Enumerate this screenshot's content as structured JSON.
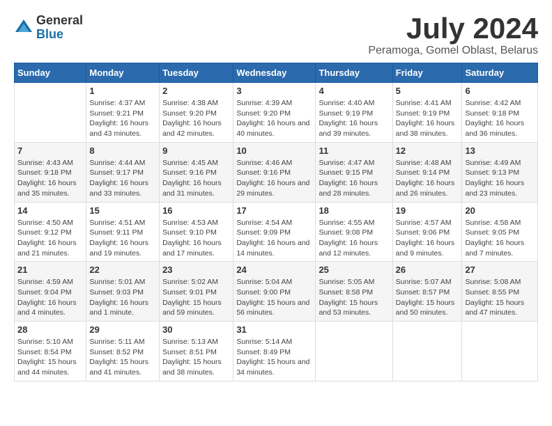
{
  "logo": {
    "general": "General",
    "blue": "Blue"
  },
  "title": {
    "month_year": "July 2024",
    "location": "Peramoga, Gomel Oblast, Belarus"
  },
  "headers": [
    "Sunday",
    "Monday",
    "Tuesday",
    "Wednesday",
    "Thursday",
    "Friday",
    "Saturday"
  ],
  "weeks": [
    [
      {
        "day": "",
        "info": ""
      },
      {
        "day": "1",
        "info": "Sunrise: 4:37 AM\nSunset: 9:21 PM\nDaylight: 16 hours and 43 minutes."
      },
      {
        "day": "2",
        "info": "Sunrise: 4:38 AM\nSunset: 9:20 PM\nDaylight: 16 hours and 42 minutes."
      },
      {
        "day": "3",
        "info": "Sunrise: 4:39 AM\nSunset: 9:20 PM\nDaylight: 16 hours and 40 minutes."
      },
      {
        "day": "4",
        "info": "Sunrise: 4:40 AM\nSunset: 9:19 PM\nDaylight: 16 hours and 39 minutes."
      },
      {
        "day": "5",
        "info": "Sunrise: 4:41 AM\nSunset: 9:19 PM\nDaylight: 16 hours and 38 minutes."
      },
      {
        "day": "6",
        "info": "Sunrise: 4:42 AM\nSunset: 9:18 PM\nDaylight: 16 hours and 36 minutes."
      }
    ],
    [
      {
        "day": "7",
        "info": "Sunrise: 4:43 AM\nSunset: 9:18 PM\nDaylight: 16 hours and 35 minutes."
      },
      {
        "day": "8",
        "info": "Sunrise: 4:44 AM\nSunset: 9:17 PM\nDaylight: 16 hours and 33 minutes."
      },
      {
        "day": "9",
        "info": "Sunrise: 4:45 AM\nSunset: 9:16 PM\nDaylight: 16 hours and 31 minutes."
      },
      {
        "day": "10",
        "info": "Sunrise: 4:46 AM\nSunset: 9:16 PM\nDaylight: 16 hours and 29 minutes."
      },
      {
        "day": "11",
        "info": "Sunrise: 4:47 AM\nSunset: 9:15 PM\nDaylight: 16 hours and 28 minutes."
      },
      {
        "day": "12",
        "info": "Sunrise: 4:48 AM\nSunset: 9:14 PM\nDaylight: 16 hours and 26 minutes."
      },
      {
        "day": "13",
        "info": "Sunrise: 4:49 AM\nSunset: 9:13 PM\nDaylight: 16 hours and 23 minutes."
      }
    ],
    [
      {
        "day": "14",
        "info": "Sunrise: 4:50 AM\nSunset: 9:12 PM\nDaylight: 16 hours and 21 minutes."
      },
      {
        "day": "15",
        "info": "Sunrise: 4:51 AM\nSunset: 9:11 PM\nDaylight: 16 hours and 19 minutes."
      },
      {
        "day": "16",
        "info": "Sunrise: 4:53 AM\nSunset: 9:10 PM\nDaylight: 16 hours and 17 minutes."
      },
      {
        "day": "17",
        "info": "Sunrise: 4:54 AM\nSunset: 9:09 PM\nDaylight: 16 hours and 14 minutes."
      },
      {
        "day": "18",
        "info": "Sunrise: 4:55 AM\nSunset: 9:08 PM\nDaylight: 16 hours and 12 minutes."
      },
      {
        "day": "19",
        "info": "Sunrise: 4:57 AM\nSunset: 9:06 PM\nDaylight: 16 hours and 9 minutes."
      },
      {
        "day": "20",
        "info": "Sunrise: 4:58 AM\nSunset: 9:05 PM\nDaylight: 16 hours and 7 minutes."
      }
    ],
    [
      {
        "day": "21",
        "info": "Sunrise: 4:59 AM\nSunset: 9:04 PM\nDaylight: 16 hours and 4 minutes."
      },
      {
        "day": "22",
        "info": "Sunrise: 5:01 AM\nSunset: 9:03 PM\nDaylight: 16 hours and 1 minute."
      },
      {
        "day": "23",
        "info": "Sunrise: 5:02 AM\nSunset: 9:01 PM\nDaylight: 15 hours and 59 minutes."
      },
      {
        "day": "24",
        "info": "Sunrise: 5:04 AM\nSunset: 9:00 PM\nDaylight: 15 hours and 56 minutes."
      },
      {
        "day": "25",
        "info": "Sunrise: 5:05 AM\nSunset: 8:58 PM\nDaylight: 15 hours and 53 minutes."
      },
      {
        "day": "26",
        "info": "Sunrise: 5:07 AM\nSunset: 8:57 PM\nDaylight: 15 hours and 50 minutes."
      },
      {
        "day": "27",
        "info": "Sunrise: 5:08 AM\nSunset: 8:55 PM\nDaylight: 15 hours and 47 minutes."
      }
    ],
    [
      {
        "day": "28",
        "info": "Sunrise: 5:10 AM\nSunset: 8:54 PM\nDaylight: 15 hours and 44 minutes."
      },
      {
        "day": "29",
        "info": "Sunrise: 5:11 AM\nSunset: 8:52 PM\nDaylight: 15 hours and 41 minutes."
      },
      {
        "day": "30",
        "info": "Sunrise: 5:13 AM\nSunset: 8:51 PM\nDaylight: 15 hours and 38 minutes."
      },
      {
        "day": "31",
        "info": "Sunrise: 5:14 AM\nSunset: 8:49 PM\nDaylight: 15 hours and 34 minutes."
      },
      {
        "day": "",
        "info": ""
      },
      {
        "day": "",
        "info": ""
      },
      {
        "day": "",
        "info": ""
      }
    ]
  ]
}
